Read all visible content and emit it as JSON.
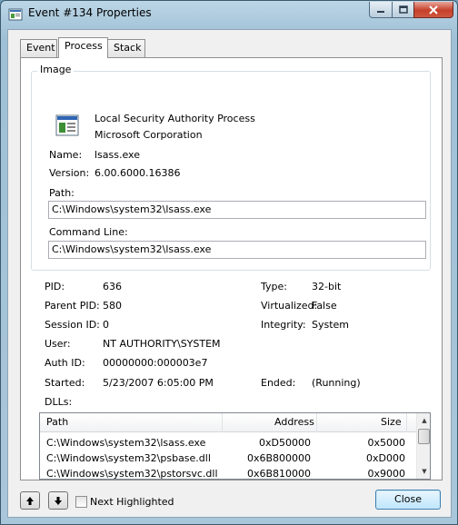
{
  "window": {
    "title": "Event #134 Properties",
    "controls": {
      "minimize": "minimize-icon",
      "maximize": "maximize-icon",
      "close": "close-icon"
    }
  },
  "tabs": [
    {
      "label": "Event"
    },
    {
      "label": "Process",
      "active": true
    },
    {
      "label": "Stack"
    }
  ],
  "image": {
    "group_label": "Image",
    "description": "Local Security Authority Process",
    "company": "Microsoft Corporation",
    "name_label": "Name:",
    "name": "lsass.exe",
    "version_label": "Version:",
    "version": "6.00.6000.16386",
    "path_label": "Path:",
    "path": "C:\\Windows\\system32\\lsass.exe",
    "cmdline_label": "Command Line:",
    "cmdline": "C:\\Windows\\system32\\lsass.exe"
  },
  "process": {
    "pid_label": "PID:",
    "pid": "636",
    "parent_pid_label": "Parent PID:",
    "parent_pid": "580",
    "session_label": "Session ID:",
    "session": "0",
    "user_label": "User:",
    "user": "NT AUTHORITY\\SYSTEM",
    "auth_label": "Auth ID:",
    "auth": "00000000:000003e7",
    "started_label": "Started:",
    "started": "5/23/2007 6:05:00 PM",
    "type_label": "Type:",
    "type": "32-bit",
    "virtualized_label": "Virtualized:",
    "virtualized": "False",
    "integrity_label": "Integrity:",
    "integrity": "System",
    "ended_label": "Ended:",
    "ended": "(Running)"
  },
  "dlls": {
    "label": "DLLs:",
    "columns": [
      "Path",
      "Address",
      "Size"
    ],
    "rows": [
      {
        "path": "C:\\Windows\\system32\\lsass.exe",
        "address": "0xD50000",
        "size": "0x5000"
      },
      {
        "path": "C:\\Windows\\system32\\psbase.dll",
        "address": "0x6B800000",
        "size": "0xD000"
      },
      {
        "path": "C:\\Windows\\system32\\pstorsvc.dll",
        "address": "0x6B810000",
        "size": "0x9000"
      }
    ]
  },
  "footer": {
    "next_highlighted_label": "Next Highlighted",
    "next_highlighted_checked": false,
    "close_label": "Close"
  }
}
